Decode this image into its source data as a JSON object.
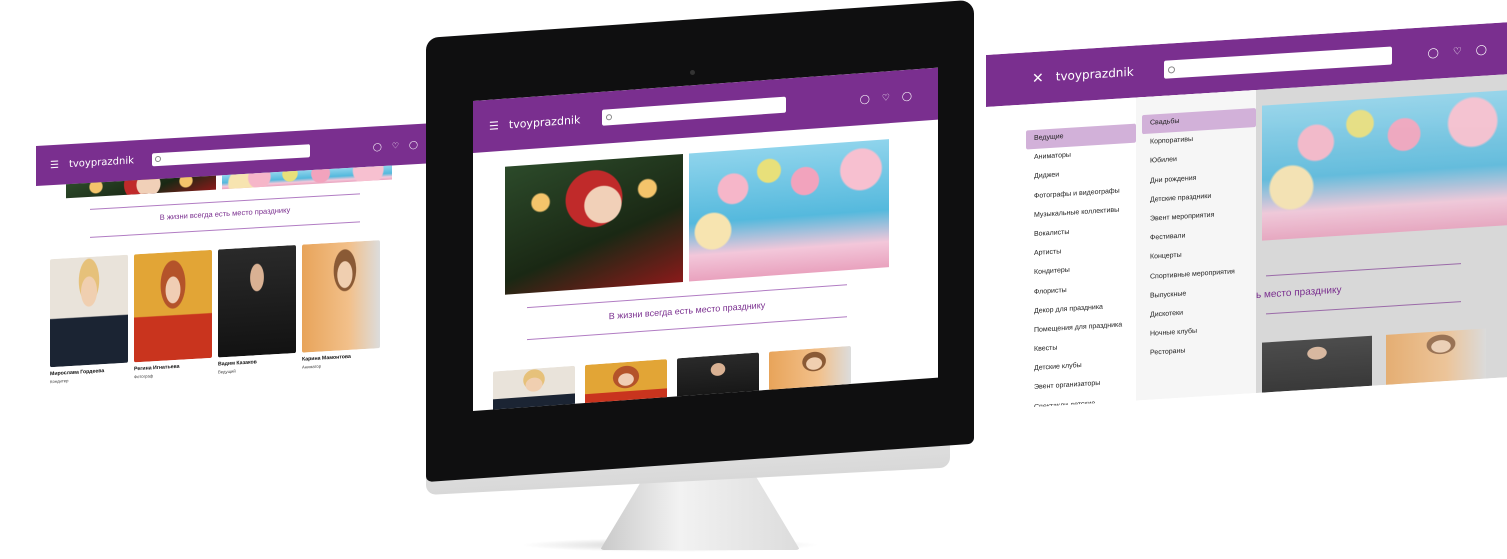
{
  "brand": {
    "name": "tvoyprazdnik",
    "accent": "#7a2f8f"
  },
  "header": {
    "search_placeholder": "",
    "icons": [
      "menu-icon",
      "search-icon",
      "chat-icon",
      "heart-icon",
      "user-icon",
      "close-icon"
    ]
  },
  "slogan": "В жизни всегда есть место празднику",
  "slogan_partial": "ь место празднику",
  "artists": [
    {
      "name": "Мирослава Гордеева",
      "role": "Кондитер"
    },
    {
      "name": "Регина Игнатьева",
      "role": "Фотограф"
    },
    {
      "name": "Вадим Казаков",
      "role": "Ведущий"
    },
    {
      "name": "Карина Мамонтова",
      "role": "Аниматор"
    }
  ],
  "menu": {
    "categories": [
      "Ведущие",
      "Аниматоры",
      "Диджеи",
      "Фотографы и видеографы",
      "Музыкальные коллективы",
      "Вокалисты",
      "Артисты",
      "Кондитеры",
      "Флористы",
      "Декор для праздника",
      "Помещения для праздника",
      "Квесты",
      "Детские клубы",
      "Эвент организаторы",
      "Спектакли детские"
    ],
    "events": [
      "Свадьбы",
      "Корпоративы",
      "Юбилеи",
      "Дни рождения",
      "Детские праздники",
      "Эвент мероприятия",
      "Фестивали",
      "Концерты",
      "Спортивные мероприятия",
      "Выпускные",
      "Дискотеки",
      "Ночные клубы",
      "Рестораны"
    ],
    "active_category": "Ведущие",
    "active_event": "Свадьбы"
  },
  "device": {
    "logo": "apple-logo-icon"
  }
}
